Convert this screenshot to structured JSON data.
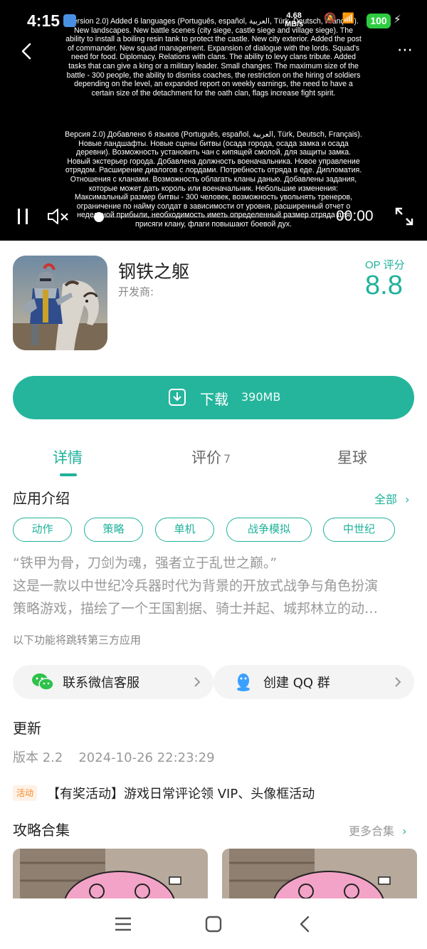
{
  "status_bar": {
    "time": "4:15",
    "net_speed_value": "4.68",
    "net_speed_unit": "MB/s",
    "battery": "100"
  },
  "video": {
    "subtitle_en": "Version 2.0) Added 6 languages (Português, español, العربية, Türk, Deutsch, Français). New landscapes. New battle scenes (city siege, castle siege and village siege). The ability to install a boiling resin tank to protect the castle. New city exterior. Added the post of commander. New squad management. Expansion of dialogue with the lords. Squad's need for food. Diplomacy. Relations with clans. The ability to levy clans tribute. Added tasks that can give a king or a military leader. Small changes: The maximum size of the battle - 300 people, the ability to dismiss coaches, the restriction on the hiring of soldiers depending on the level, an expanded report on weekly earnings, the need to have a certain size of the detachment for the oath clan, flags increase fight spirit.",
    "subtitle_ru": "Версия 2.0) Добавлено 6 языков (Português, español, العربية, Türk, Deutsch, Français). Новые ландшафты. Новые сцены битвы (осада города, осада замка и осада деревни). Возможность установить чан с кипящей смолой, для защиты замка. Новый экстерьер города. Добавлена должность военачальника. Новое управление отрядом. Расширение диалогов с лордами. Потребность отряда в еде. Дипломатия. Отношения с кланами. Возможность облагать кланы данью. Добавлены задания, которые может дать король или военачальник. Небольшие изменения: Максимальный размер битвы - 300 человек, возможность увольнять тренеров, ограничение по найму солдат в зависимости от уровня, расширенный отчет о недельной прибыли, необходимость иметь определенный размер отряда для присяги клану, флаги повышают боевой дух.",
    "time_display": "00:00",
    "progress": 0.0
  },
  "app": {
    "name": "钢铁之躯",
    "developer_label": "开发商:",
    "score_label": "OP 评分",
    "score": "8.8"
  },
  "download": {
    "label": "下载",
    "size": "390MB"
  },
  "tabs": [
    {
      "label": "详情",
      "count": ""
    },
    {
      "label": "评价",
      "count": "7"
    },
    {
      "label": "星球",
      "count": ""
    }
  ],
  "intro": {
    "title": "应用介绍",
    "more": "全部",
    "tags": [
      "动作",
      "策略",
      "单机",
      "战争模拟",
      "中世纪"
    ],
    "desc_lines": [
      "“铁甲为骨，刀剑为魂，强者立于乱世之巅。”",
      "这是一款以中世纪冷兵器时代为背景的开放式战争与角色扮演",
      "策略游戏，描绘了一个王国割据、骑士并起、城邦林立的动…"
    ],
    "third_party_note": "以下功能将跳转第三方应用"
  },
  "contacts": {
    "wechat": "联系微信客服",
    "qq": "创建 QQ 群"
  },
  "update": {
    "title": "更新",
    "version": "版本 2.2",
    "datetime": "2024-10-26 22:23:29",
    "promo_badge": "活动",
    "promo_text": "【有奖活动】游戏日常评论领 VIP、头像框活动"
  },
  "guides": {
    "title": "攻略合集",
    "more": "更多合集"
  },
  "colors": {
    "accent": "#1fb29b",
    "download_bg": "#25b59c",
    "video_bg": "#000000",
    "promo": "#f08a2b"
  }
}
